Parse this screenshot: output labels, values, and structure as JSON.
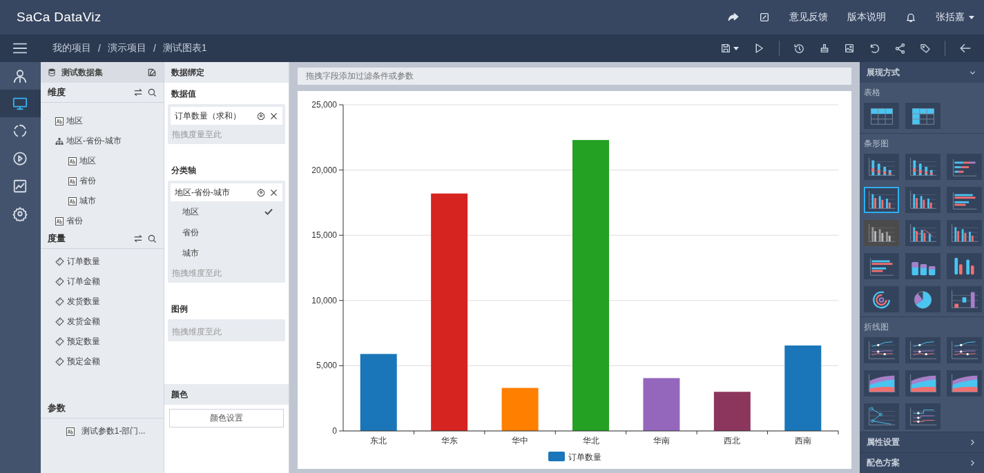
{
  "header": {
    "logo": "SaCa DataViz",
    "links": [
      {
        "label": "意见反馈"
      },
      {
        "label": "版本说明"
      }
    ],
    "user": "张括嘉"
  },
  "breadcrumb": [
    {
      "label": "我的项目"
    },
    {
      "separator": "/",
      "label": "演示项目"
    },
    {
      "separator": "/",
      "label": "测试图表1"
    }
  ],
  "nav": [
    {
      "kind": "user",
      "selected": false
    },
    {
      "kind": "monitor",
      "selected": true
    },
    {
      "kind": "ring",
      "selected": false
    },
    {
      "kind": "play",
      "selected": false
    },
    {
      "kind": "trend",
      "selected": false
    },
    {
      "kind": "gear",
      "selected": false
    }
  ],
  "dataset": {
    "title": "测试数据集",
    "dimensions": {
      "title": "维度",
      "items": [
        {
          "label": "地区",
          "kind": "text"
        },
        {
          "label": "地区-省份-城市",
          "kind": "hierarchy",
          "children": [
            {
              "label": "地区",
              "kind": "text"
            },
            {
              "label": "省份",
              "kind": "text"
            },
            {
              "label": "城市",
              "kind": "text"
            }
          ]
        },
        {
          "label": "省份",
          "kind": "text"
        }
      ]
    },
    "measures": {
      "title": "度量",
      "items": [
        {
          "label": "订单数量"
        },
        {
          "label": "订单金额"
        },
        {
          "label": "发货数量"
        },
        {
          "label": "发货金额"
        },
        {
          "label": "预定数量"
        },
        {
          "label": "预定金额"
        }
      ]
    },
    "params": {
      "title": "参数",
      "items": [
        {
          "label": "测试参数1-部门..."
        }
      ]
    }
  },
  "binding": {
    "title": "数据绑定",
    "sections": [
      {
        "title": "数据值",
        "chips": [
          {
            "label": "订单数量（求和）"
          }
        ],
        "placeholder": "拖拽度量至此"
      },
      {
        "title": "分类轴",
        "chips": [
          {
            "label": "地区-省份-城市",
            "levels": [
              {
                "label": "地区",
                "checked": true
              },
              {
                "label": "省份",
                "checked": false
              },
              {
                "label": "城市",
                "checked": false
              }
            ]
          }
        ],
        "placeholder": "拖拽维度至此"
      },
      {
        "title": "图例",
        "placeholder": "拖拽维度至此"
      }
    ],
    "color": {
      "title": "颜色",
      "button": "颜色设置"
    }
  },
  "filter_bar": {
    "placeholder": "拖拽字段添加过滤条件或参数"
  },
  "chart_data": {
    "type": "bar",
    "categories": [
      "东北",
      "华东",
      "华中",
      "华北",
      "华南",
      "西北",
      "西南"
    ],
    "series": [
      {
        "name": "订单数量",
        "color": [
          "#1a76b8",
          "#d62421",
          "#ff7f00",
          "#24a023",
          "#9467bd",
          "#8c365e",
          "#1a76b8"
        ],
        "values": [
          5900,
          18200,
          3300,
          22300,
          4050,
          3000,
          6550
        ]
      }
    ],
    "ylim": [
      0,
      25000
    ],
    "grid": true,
    "yticks": [
      {
        "value": 0,
        "label": "0"
      },
      {
        "value": 5000,
        "label": "5,000"
      },
      {
        "value": 10000,
        "label": "10,000"
      },
      {
        "value": 15000,
        "label": "15,000"
      },
      {
        "value": 20000,
        "label": "20,000"
      },
      {
        "value": 25000,
        "label": "25,000"
      }
    ]
  },
  "display": {
    "title": "展现方式",
    "expanded": true,
    "groups": [
      {
        "title": "表格",
        "types": [
          {
            "kind": "table",
            "selected": false,
            "disabled": false
          },
          {
            "kind": "crosstab",
            "selected": false,
            "disabled": false
          }
        ]
      },
      {
        "title": "条形图",
        "types": [
          {
            "kind": "stacked",
            "selected": false,
            "disabled": false
          },
          {
            "kind": "stacked",
            "selected": false,
            "disabled": false
          },
          {
            "kind": "hstacked",
            "selected": false,
            "disabled": false
          },
          {
            "kind": "bar",
            "selected": true,
            "disabled": false
          },
          {
            "kind": "bar",
            "selected": false,
            "disabled": false
          },
          {
            "kind": "hbar",
            "selected": false,
            "disabled": false
          },
          {
            "kind": "bar",
            "selected": false,
            "disabled": true
          },
          {
            "kind": "barline",
            "selected": false,
            "disabled": false
          },
          {
            "kind": "bar",
            "selected": false,
            "disabled": false
          },
          {
            "kind": "hbar",
            "selected": false,
            "disabled": false
          },
          {
            "kind": "cube",
            "selected": false,
            "disabled": false
          },
          {
            "kind": "cylinder",
            "selected": false,
            "disabled": false
          },
          {
            "kind": "ring",
            "selected": false,
            "disabled": false
          },
          {
            "kind": "pie",
            "selected": false,
            "disabled": false
          },
          {
            "kind": "waterfall",
            "selected": false,
            "disabled": false
          }
        ]
      },
      {
        "title": "折线图",
        "types": [
          {
            "kind": "line",
            "selected": false,
            "disabled": false
          },
          {
            "kind": "line",
            "selected": false,
            "disabled": false
          },
          {
            "kind": "line",
            "selected": false,
            "disabled": false
          },
          {
            "kind": "area",
            "selected": false,
            "disabled": false
          },
          {
            "kind": "area",
            "selected": false,
            "disabled": false
          },
          {
            "kind": "area",
            "selected": false,
            "disabled": false
          },
          {
            "kind": "zigzag",
            "selected": false,
            "disabled": false
          },
          {
            "kind": "step",
            "selected": false,
            "disabled": false
          }
        ]
      }
    ]
  },
  "panels": [
    {
      "title": "属性设置"
    },
    {
      "title": "配色方案"
    }
  ]
}
